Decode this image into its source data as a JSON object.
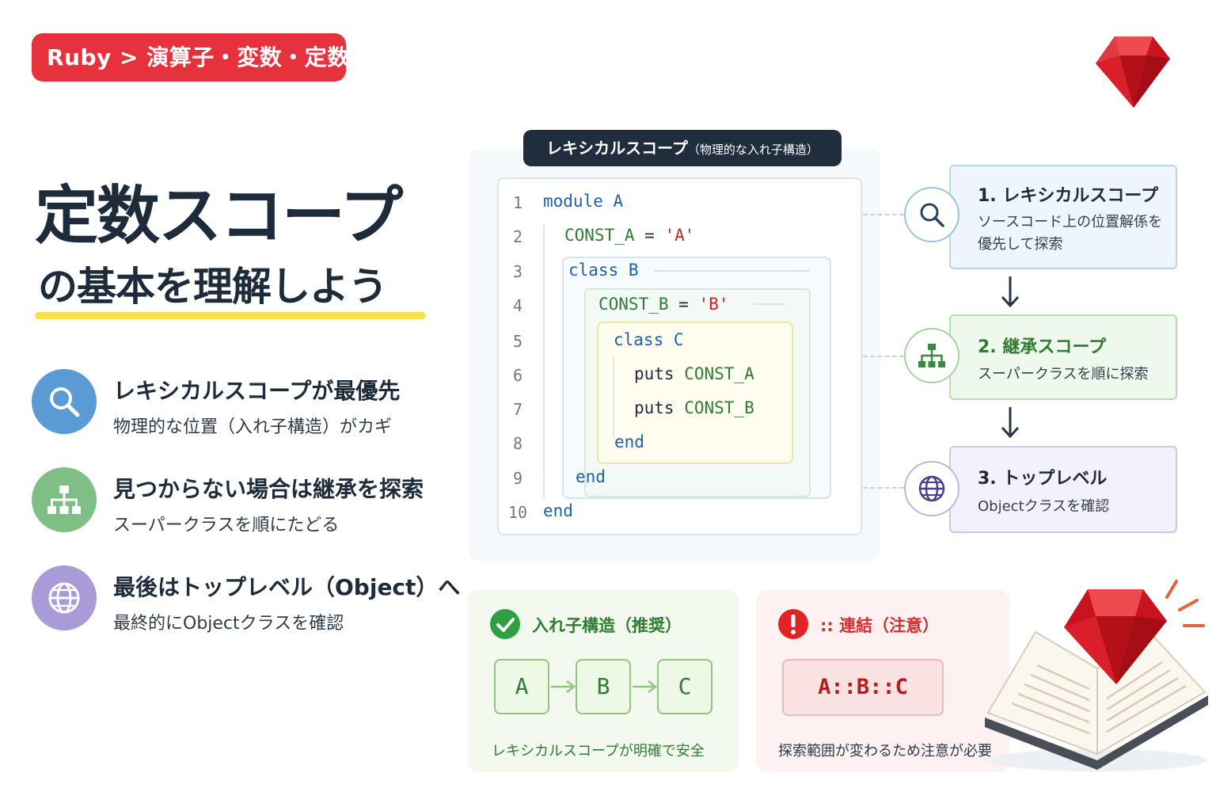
{
  "breadcrumb": "Ruby > 演算子・変数・定数",
  "headline": {
    "line1": "定数スコープ",
    "line2": "の基本を理解しよう"
  },
  "features": [
    {
      "icon": "search-icon",
      "title": "レキシカルスコープが最優先",
      "desc": "物理的な位置（入れ子構造）がカギ"
    },
    {
      "icon": "hierarchy-icon",
      "title": "見つからない場合は継承を探索",
      "desc": "スーパークラスを順にたどる"
    },
    {
      "icon": "globe-icon",
      "title": "最後はトップレベル（Object）へ",
      "desc": "最終的にObjectクラスを確認"
    }
  ],
  "code_panel": {
    "title": "レキシカルスコープ",
    "title_note": "（物理的な入れ子構造）",
    "line_numbers": [
      "1",
      "2",
      "3",
      "4",
      "5",
      "6",
      "7",
      "8",
      "9",
      "10"
    ],
    "lines": {
      "l1_kw": "module",
      "l1_name": "A",
      "l2_const": "CONST_A",
      "l2_op": "=",
      "l2_str": "'A'",
      "l3_kw": "class",
      "l3_name": "B",
      "l4_const": "CONST_B",
      "l4_op": "=",
      "l4_str": "'B'",
      "l5_kw": "class",
      "l5_name": "C",
      "l6_call": "puts",
      "l6_const": "CONST_A",
      "l7_call": "puts",
      "l7_const": "CONST_B",
      "l8_kw": "end",
      "l9_kw": "end",
      "l10_kw": "end"
    }
  },
  "lookup_steps": [
    {
      "icon": "search-icon",
      "title": "1. レキシカルスコープ",
      "desc1": "ソースコード上の位置解係を",
      "desc2": "優先して探索"
    },
    {
      "icon": "hierarchy-icon",
      "title": "2. 継承スコープ",
      "desc1": "スーパークラスを順に探索"
    },
    {
      "icon": "globe-icon",
      "title": "3. トップレベル",
      "desc1": "Objectクラスを確認"
    }
  ],
  "compare": {
    "recommended": {
      "title": "入れ子構造（推奨）",
      "nodes": [
        "A",
        "B",
        "C"
      ],
      "footer": "レキシカルスコープが明確で安全"
    },
    "caution": {
      "title": ":: 連結（注意）",
      "path": "A::B::C",
      "footer": "探索範囲が変わるため注意が必要"
    }
  },
  "colors": {
    "accent_red": "#e5323d",
    "navy": "#1f2d3d",
    "blue": "#5b9bd5",
    "green": "#7fbf7f",
    "purple": "#a99ad8",
    "highlight_yellow": "#fce14a"
  }
}
